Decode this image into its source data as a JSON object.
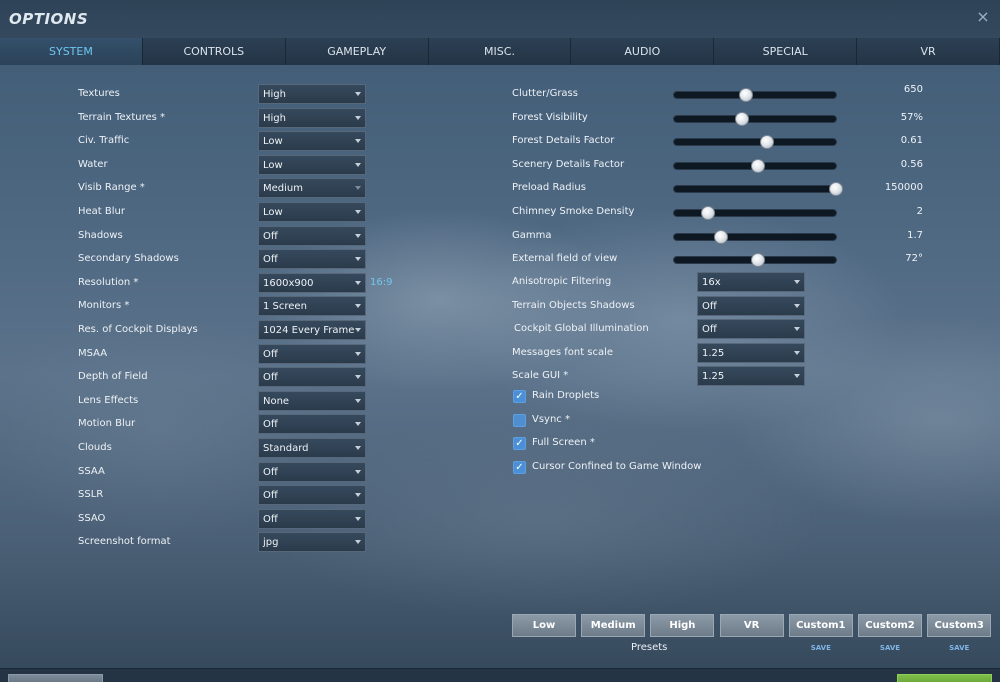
{
  "window": {
    "title": "OPTIONS",
    "close_glyph": "×"
  },
  "tabs": [
    {
      "label": "SYSTEM",
      "active": true
    },
    {
      "label": "CONTROLS",
      "active": false
    },
    {
      "label": "GAMEPLAY",
      "active": false
    },
    {
      "label": "MISC.",
      "active": false
    },
    {
      "label": "AUDIO",
      "active": false
    },
    {
      "label": "SPECIAL",
      "active": false
    },
    {
      "label": "VR",
      "active": false
    }
  ],
  "left_settings": [
    {
      "label": "Textures",
      "value": "High"
    },
    {
      "label": "Terrain Textures *",
      "value": "High"
    },
    {
      "label": "Civ. Traffic",
      "value": "Low"
    },
    {
      "label": "Water",
      "value": "Low"
    },
    {
      "label": "Visib Range *",
      "value": "Medium",
      "disabled": true
    },
    {
      "label": "Heat Blur",
      "value": "Low"
    },
    {
      "label": "Shadows",
      "value": "Off"
    },
    {
      "label": "Secondary Shadows",
      "value": "Off"
    },
    {
      "label": "Resolution *",
      "value": "1600x900",
      "aspect": "16:9"
    },
    {
      "label": "Monitors *",
      "value": "1 Screen"
    },
    {
      "label": "Res. of Cockpit Displays",
      "value": "1024 Every Frame"
    },
    {
      "label": "MSAA",
      "value": "Off"
    },
    {
      "label": "Depth of Field",
      "value": "Off"
    },
    {
      "label": "Lens Effects",
      "value": "None"
    },
    {
      "label": "Motion Blur",
      "value": "Off"
    },
    {
      "label": "Clouds",
      "value": "Standard"
    },
    {
      "label": "SSAA",
      "value": "Off"
    },
    {
      "label": "SSLR",
      "value": "Off"
    },
    {
      "label": "SSAO",
      "value": "Off"
    },
    {
      "label": "Screenshot format",
      "value": "jpg"
    }
  ],
  "sliders": [
    {
      "label": "Clutter/Grass",
      "value": "650",
      "fraction": 0.44
    },
    {
      "label": "Forest Visibility",
      "value": "57%",
      "fraction": 0.41
    },
    {
      "label": "Forest Details Factor",
      "value": "0.61",
      "fraction": 0.57
    },
    {
      "label": "Scenery Details Factor",
      "value": "0.56",
      "fraction": 0.51
    },
    {
      "label": "Preload Radius",
      "value": "150000",
      "fraction": 1.0
    },
    {
      "label": "Chimney Smoke Density",
      "value": "2",
      "fraction": 0.2
    },
    {
      "label": "Gamma",
      "value": "1.7",
      "fraction": 0.28
    },
    {
      "label": "External field of view",
      "value": "72°",
      "fraction": 0.51
    }
  ],
  "right_selects": [
    {
      "label": "Anisotropic Filtering",
      "value": "16x"
    },
    {
      "label": "Terrain Objects Shadows",
      "value": "Off"
    },
    {
      "label": "Cockpit Global Illumination",
      "value": "Off"
    },
    {
      "label": "Messages font scale",
      "value": "1.25"
    },
    {
      "label": "Scale GUI *",
      "value": "1.25"
    }
  ],
  "checkboxes": [
    {
      "label": "Rain Droplets",
      "checked": true
    },
    {
      "label": "Vsync *",
      "checked": false
    },
    {
      "label": "Full Screen *",
      "checked": true
    },
    {
      "label": "Cursor Confined to Game Window",
      "checked": true
    }
  ],
  "presets": {
    "label": "Presets",
    "buttons": [
      {
        "label": "Low",
        "save": ""
      },
      {
        "label": "Medium",
        "save": ""
      },
      {
        "label": "High",
        "save": ""
      },
      {
        "label": "VR",
        "save": ""
      },
      {
        "label": "Custom1",
        "save": "SAVE"
      },
      {
        "label": "Custom2",
        "save": "SAVE"
      },
      {
        "label": "Custom3",
        "save": "SAVE"
      }
    ]
  },
  "icons": {
    "close": "close-icon",
    "dropdown": "chevron-down-icon",
    "check": "checkmark-icon"
  },
  "colors": {
    "accent": "#6fc7ef",
    "checkbox": "#4b8fd6",
    "confirm": "#7fbf4a"
  }
}
